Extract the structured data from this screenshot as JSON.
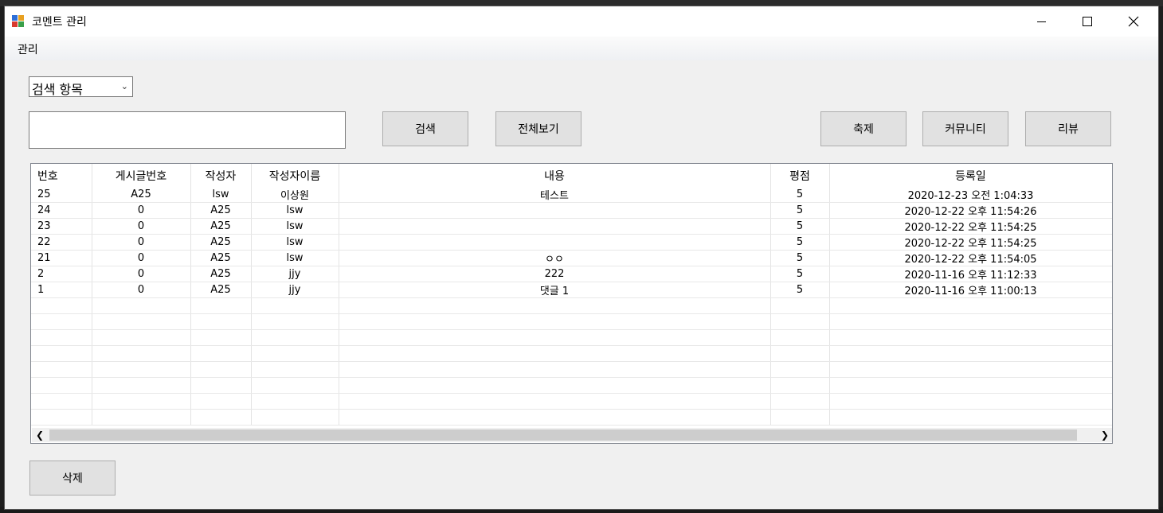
{
  "window": {
    "title": "코멘트 관리"
  },
  "menu": {
    "items": [
      "관리"
    ]
  },
  "search": {
    "combo_value": "검색 항목",
    "input_value": "",
    "search_label": "검색",
    "show_all_label": "전체보기"
  },
  "categories": {
    "festival_label": "축제",
    "community_label": "커뮤니티",
    "review_label": "리뷰"
  },
  "grid": {
    "columns": [
      "번호",
      "게시글번호",
      "작성자",
      "작성자이름",
      "내용",
      "평점",
      "등록일"
    ],
    "rows": [
      [
        "25",
        "A25",
        "lsw",
        "이상원",
        "테스트",
        "5",
        "2020-12-23 오전 1:04:33"
      ],
      [
        "24",
        "0",
        "A25",
        "lsw",
        "",
        "5",
        "2020-12-22 오후 11:54:26"
      ],
      [
        "23",
        "0",
        "A25",
        "lsw",
        "",
        "5",
        "2020-12-22 오후 11:54:25"
      ],
      [
        "22",
        "0",
        "A25",
        "lsw",
        "",
        "5",
        "2020-12-22 오후 11:54:25"
      ],
      [
        "21",
        "0",
        "A25",
        "lsw",
        "ㅇㅇ",
        "5",
        "2020-12-22 오후 11:54:05"
      ],
      [
        "2",
        "0",
        "A25",
        "jjy",
        "222",
        "5",
        "2020-11-16 오후 11:12:33"
      ],
      [
        "1",
        "0",
        "A25",
        "jjy",
        "댓글 1",
        "5",
        "2020-11-16 오후 11:00:13"
      ]
    ],
    "empty_rows": 8
  },
  "actions": {
    "delete_label": "삭제"
  }
}
